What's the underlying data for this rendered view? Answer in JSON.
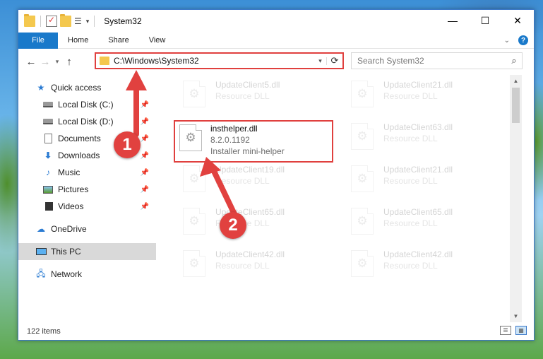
{
  "window": {
    "title": "System32",
    "controls": {
      "minimize": "—",
      "maximize": "☐",
      "close": "✕"
    }
  },
  "ribbon": {
    "tabs": [
      "File",
      "Home",
      "Share",
      "View"
    ],
    "help": "?"
  },
  "nav": {
    "address": "C:\\Windows\\System32",
    "search_placeholder": "Search System32"
  },
  "sidebar": {
    "items": [
      {
        "label": "Quick access",
        "icon": "star-icon",
        "level": 0,
        "pinned": false
      },
      {
        "label": "Local Disk (C:)",
        "icon": "drive-icon",
        "level": 1,
        "pinned": true
      },
      {
        "label": "Local Disk (D:)",
        "icon": "drive-icon",
        "level": 1,
        "pinned": true
      },
      {
        "label": "Documents",
        "icon": "document-icon",
        "level": 1,
        "pinned": true
      },
      {
        "label": "Downloads",
        "icon": "download-icon",
        "level": 1,
        "pinned": true
      },
      {
        "label": "Music",
        "icon": "music-icon",
        "level": 1,
        "pinned": true
      },
      {
        "label": "Pictures",
        "icon": "picture-icon",
        "level": 1,
        "pinned": true
      },
      {
        "label": "Videos",
        "icon": "video-icon",
        "level": 1,
        "pinned": true
      },
      {
        "label": "OneDrive",
        "icon": "cloud-icon",
        "level": 0,
        "pinned": false
      },
      {
        "label": "This PC",
        "icon": "pc-icon",
        "level": 0,
        "pinned": false,
        "selected": true
      },
      {
        "label": "Network",
        "icon": "network-icon",
        "level": 0,
        "pinned": false
      }
    ]
  },
  "files": {
    "left": [
      {
        "name": "UpdateClient5.dll",
        "sub": "Resource DLL"
      },
      {
        "name": "insthelper.dll",
        "version": "8.2.0.1192",
        "sub": "Installer mini-helper",
        "highlighted": true
      },
      {
        "name": "UpdateClient19.dll",
        "sub": "Resource DLL"
      },
      {
        "name": "UpdateClient65.dll",
        "sub": "Resource DLL"
      },
      {
        "name": "UpdateClient42.dll",
        "sub": "Resource DLL"
      }
    ],
    "right": [
      {
        "name": "UpdateClient21.dll",
        "sub": "Resource DLL"
      },
      {
        "name": "UpdateClient63.dll",
        "sub": "Resource DLL"
      },
      {
        "name": "UpdateClient21.dll",
        "sub": "Resource DLL"
      },
      {
        "name": "UpdateClient65.dll",
        "sub": "Resource DLL"
      },
      {
        "name": "UpdateClient42.dll",
        "sub": "Resource DLL"
      }
    ]
  },
  "status": {
    "items_count": "122 items"
  },
  "annotations": {
    "badge1": "1",
    "badge2": "2",
    "color": "#e1413f"
  }
}
